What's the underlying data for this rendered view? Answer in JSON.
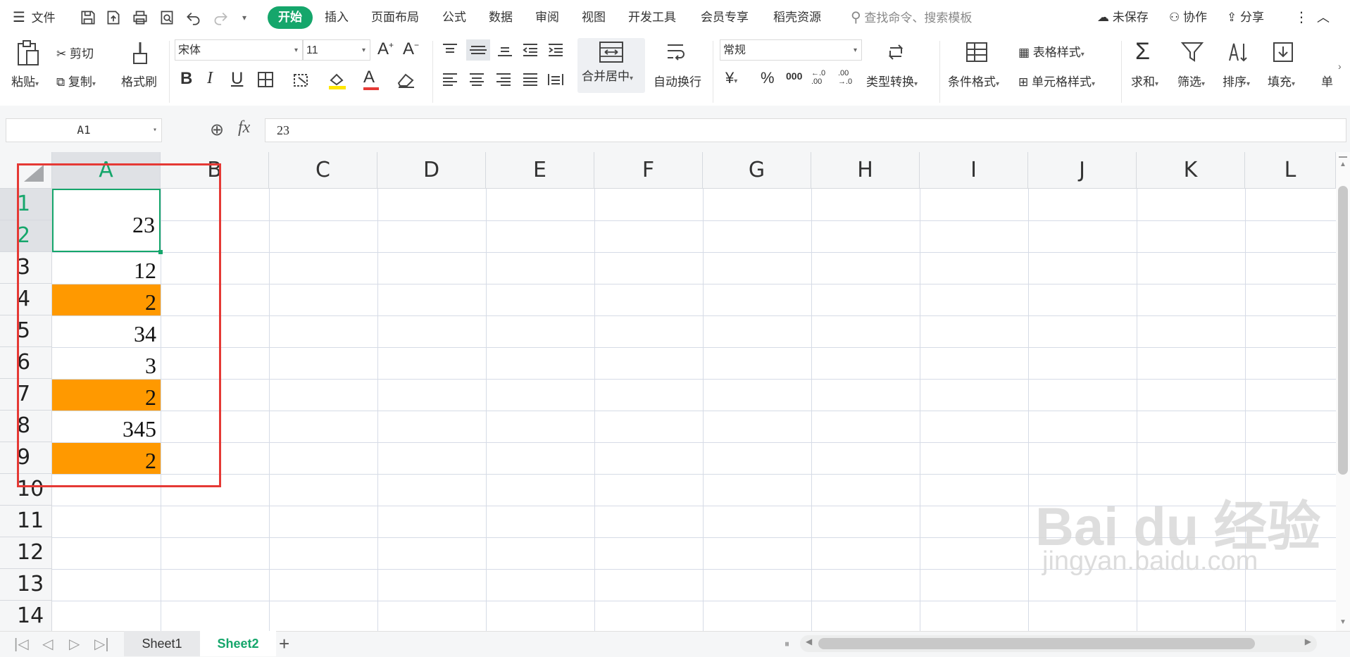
{
  "menu": {
    "file": "文件",
    "tabs": [
      "开始",
      "插入",
      "页面布局",
      "公式",
      "数据",
      "审阅",
      "视图",
      "开发工具",
      "会员专享",
      "稻壳资源"
    ],
    "search_placeholder": "查找命令、搜索模板",
    "unsaved": "未保存",
    "collab": "协作",
    "share": "分享"
  },
  "ribbon": {
    "paste": "粘贴",
    "cut": "剪切",
    "copy": "复制",
    "format_painter": "格式刷",
    "font_name": "宋体",
    "font_size": "11",
    "merge_center": "合并居中",
    "wrap_text": "自动换行",
    "number_format": "常规",
    "type_convert": "类型转换",
    "cond_format": "条件格式",
    "table_style": "表格样式",
    "cell_style": "单元格样式",
    "sum": "求和",
    "filter": "筛选",
    "sort": "排序",
    "fill": "填充",
    "single": "单",
    "bold": "B",
    "italic": "I",
    "underline": "U",
    "font_color_letter": "A",
    "currency": "¥",
    "percent": "%",
    "thousands": "000",
    "inc_decimal": "←.0\n.00",
    "dec_decimal": ".00\n→.0"
  },
  "formula": {
    "name_box": "A1",
    "fx": "fx",
    "value": "23"
  },
  "columns": [
    "A",
    "B",
    "C",
    "D",
    "E",
    "F",
    "G",
    "H",
    "I",
    "J",
    "K",
    "L"
  ],
  "rows": [
    "1",
    "2",
    "3",
    "4",
    "5",
    "6",
    "7",
    "8",
    "9",
    "10",
    "11",
    "12",
    "13",
    "14"
  ],
  "cells": [
    {
      "value": "23"
    },
    {
      "value": "12"
    },
    {
      "value": "2"
    },
    {
      "value": "34"
    },
    {
      "value": "3"
    },
    {
      "value": "2"
    },
    {
      "value": "345"
    },
    {
      "value": "2"
    }
  ],
  "colors": {
    "accent": "#15a66b",
    "highlight": "#ff9900",
    "annotation": "#e53935"
  },
  "sheets": [
    "Sheet1",
    "Sheet2"
  ],
  "watermark": {
    "brand": "Bai du 经验",
    "url": "jingyan.baidu.com"
  }
}
